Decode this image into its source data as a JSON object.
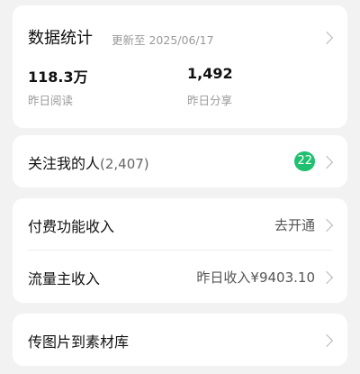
{
  "stats": {
    "title": "数据统计",
    "updated": "更新至 2025/06/17",
    "reads_value": "118.3万",
    "reads_label": "昨日阅读",
    "shares_value": "1,492",
    "shares_label": "昨日分享"
  },
  "followers": {
    "label": "关注我的人",
    "count": "(2,407)",
    "badge": "22",
    "badge_color": "#1fc06f"
  },
  "income": {
    "paid_label": "付费功能收入",
    "paid_value": "去开通",
    "traffic_label": "流量主收入",
    "traffic_value": "昨日收入¥9403.10"
  },
  "upload": {
    "label": "传图片到素材库"
  },
  "icons": {
    "chevron": "chevron-right-icon"
  }
}
